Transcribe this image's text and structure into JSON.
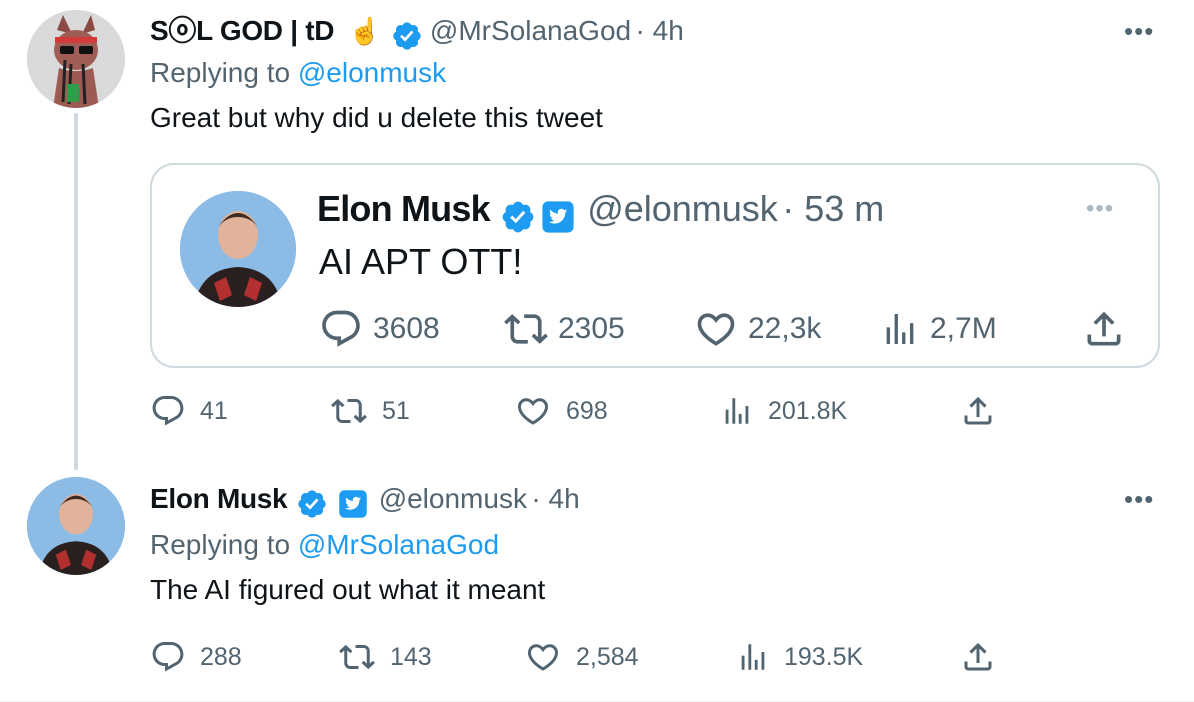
{
  "tweet1": {
    "display_name": "SⓞL GOD | tD",
    "emoji": "☝️",
    "handle": "@MrSolanaGod",
    "time": "· 4h",
    "replying_prefix": "Replying to ",
    "replying_to": "@elonmusk",
    "text": "Great but why did u delete this tweet",
    "more": "•••",
    "actions": {
      "replies": "41",
      "retweets": "51",
      "likes": "698",
      "views": "201.8K"
    }
  },
  "quote": {
    "display_name": "Elon Musk",
    "handle": "@elonmusk",
    "time": "· 53 m",
    "text": "AI APT OTT!",
    "more": "•••",
    "actions": {
      "replies": "3608",
      "retweets": "2305",
      "likes": "22,3k",
      "views": "2,7M"
    }
  },
  "tweet2": {
    "display_name": "Elon Musk",
    "handle": "@elonmusk",
    "time": "· 4h",
    "replying_prefix": "Replying to ",
    "replying_to": "@MrSolanaGod",
    "text": "The AI figured out what it meant",
    "more": "•••",
    "actions": {
      "replies": "288",
      "retweets": "143",
      "likes": "2,584",
      "views": "193.5K"
    }
  },
  "colors": {
    "verified_blue": "#1d9bf0",
    "text_primary": "#0f1419",
    "text_secondary": "#536471",
    "border": "#cfd9de"
  }
}
